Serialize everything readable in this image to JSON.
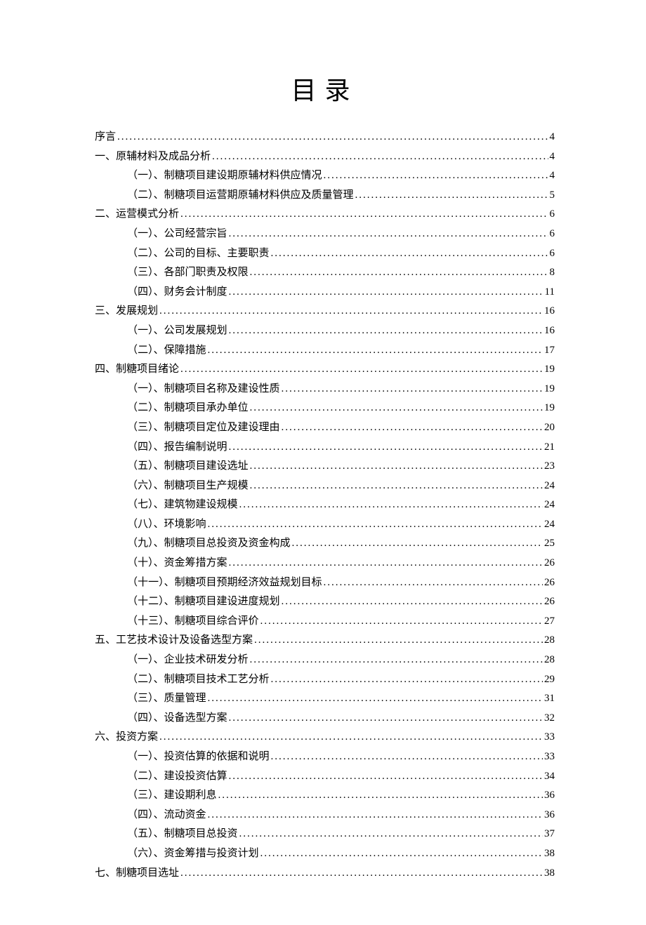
{
  "title": "目录",
  "toc": [
    {
      "level": 1,
      "label": "序言",
      "page": "4"
    },
    {
      "level": 1,
      "label": "一、原辅材料及成品分析",
      "page": "4"
    },
    {
      "level": 2,
      "label": "（一）、制糖项目建设期原辅材料供应情况",
      "page": "4"
    },
    {
      "level": 2,
      "label": "（二）、制糖项目运营期原辅材料供应及质量管理",
      "page": "5"
    },
    {
      "level": 1,
      "label": "二、运营模式分析",
      "page": "6"
    },
    {
      "level": 2,
      "label": "（一）、公司经营宗旨",
      "page": "6"
    },
    {
      "level": 2,
      "label": "（二）、公司的目标、主要职责",
      "page": "6"
    },
    {
      "level": 2,
      "label": "（三）、各部门职责及权限",
      "page": "8"
    },
    {
      "level": 2,
      "label": "（四）、财务会计制度",
      "page": "11"
    },
    {
      "level": 1,
      "label": "三、发展规划",
      "page": "16"
    },
    {
      "level": 2,
      "label": "（一）、公司发展规划",
      "page": "16"
    },
    {
      "level": 2,
      "label": "（二）、保障措施",
      "page": "17"
    },
    {
      "level": 1,
      "label": "四、制糖项目绪论",
      "page": "19"
    },
    {
      "level": 2,
      "label": "（一）、制糖项目名称及建设性质",
      "page": "19"
    },
    {
      "level": 2,
      "label": "（二）、制糖项目承办单位",
      "page": "19"
    },
    {
      "level": 2,
      "label": "（三）、制糖项目定位及建设理由",
      "page": "20"
    },
    {
      "level": 2,
      "label": "（四）、报告编制说明",
      "page": "21"
    },
    {
      "level": 2,
      "label": "（五）、制糖项目建设选址",
      "page": "23"
    },
    {
      "level": 2,
      "label": "（六）、制糖项目生产规模",
      "page": "24"
    },
    {
      "level": 2,
      "label": "（七）、建筑物建设规模",
      "page": "24"
    },
    {
      "level": 2,
      "label": "（八）、环境影响",
      "page": "24"
    },
    {
      "level": 2,
      "label": "（九）、制糖项目总投资及资金构成",
      "page": "25"
    },
    {
      "level": 2,
      "label": "（十）、资金筹措方案",
      "page": "26"
    },
    {
      "level": 2,
      "label": "（十一）、制糖项目预期经济效益规划目标",
      "page": "26"
    },
    {
      "level": 2,
      "label": "（十二）、制糖项目建设进度规划",
      "page": "26"
    },
    {
      "level": 2,
      "label": "（十三）、制糖项目综合评价",
      "page": "27"
    },
    {
      "level": 1,
      "label": "五、工艺技术设计及设备选型方案",
      "page": "28"
    },
    {
      "level": 2,
      "label": "（一）、企业技术研发分析",
      "page": "28"
    },
    {
      "level": 2,
      "label": "（二）、制糖项目技术工艺分析",
      "page": "29"
    },
    {
      "level": 2,
      "label": "（三）、质量管理",
      "page": "31"
    },
    {
      "level": 2,
      "label": "（四）、设备选型方案",
      "page": "32"
    },
    {
      "level": 1,
      "label": "六、投资方案",
      "page": "33"
    },
    {
      "level": 2,
      "label": "（一）、投资估算的依据和说明",
      "page": "33"
    },
    {
      "level": 2,
      "label": "（二）、建设投资估算",
      "page": "34"
    },
    {
      "level": 2,
      "label": "（三）、建设期利息",
      "page": "36"
    },
    {
      "level": 2,
      "label": "（四）、流动资金",
      "page": "36"
    },
    {
      "level": 2,
      "label": "（五）、制糖项目总投资",
      "page": "37"
    },
    {
      "level": 2,
      "label": "（六）、资金筹措与投资计划",
      "page": "38"
    },
    {
      "level": 1,
      "label": "七、制糖项目选址",
      "page": "38"
    }
  ]
}
